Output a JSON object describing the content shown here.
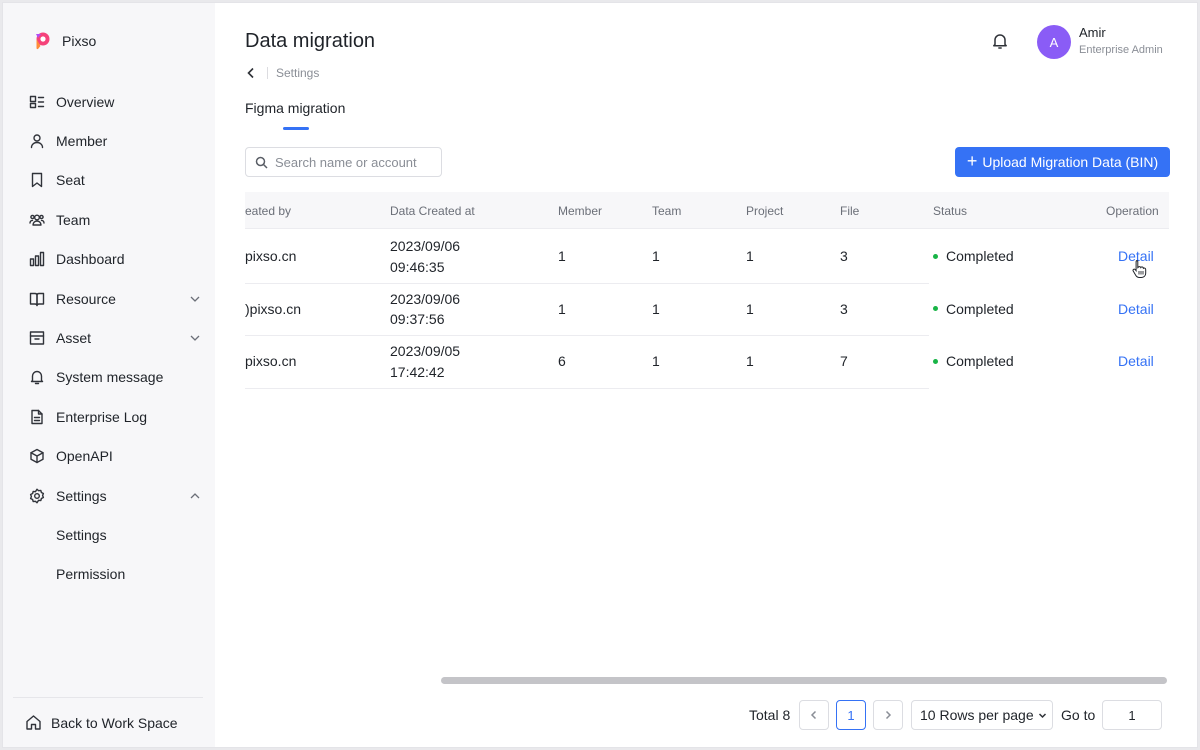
{
  "app": {
    "name": "Pixso",
    "brand_color": "#f5427a"
  },
  "sidebar": {
    "items": [
      {
        "label": "Overview",
        "icon": "overview-icon"
      },
      {
        "label": "Member",
        "icon": "user-icon"
      },
      {
        "label": "Seat",
        "icon": "bookmark-icon"
      },
      {
        "label": "Team",
        "icon": "team-icon"
      },
      {
        "label": "Dashboard",
        "icon": "bar-chart-icon"
      },
      {
        "label": "Resource",
        "icon": "book-icon",
        "expandable": true
      },
      {
        "label": "Asset",
        "icon": "archive-icon",
        "expandable": true
      },
      {
        "label": "System message",
        "icon": "bell-icon"
      },
      {
        "label": "Enterprise Log",
        "icon": "document-icon"
      },
      {
        "label": "OpenAPI",
        "icon": "cube-icon"
      },
      {
        "label": "Settings",
        "icon": "gear-icon",
        "expanded": true
      }
    ],
    "sub_items": [
      "Settings",
      "Permission"
    ],
    "back_label": "Back to Work Space"
  },
  "header": {
    "title": "Data migration",
    "breadcrumb": "Settings",
    "user": {
      "initial": "A",
      "name": "Amir",
      "role": "Enterprise Admin",
      "avatar_color": "#8a5cf6"
    }
  },
  "tabs": [
    {
      "label": "Figma migration",
      "active": true
    }
  ],
  "search": {
    "placeholder": "Search name or account",
    "value": ""
  },
  "upload_button": {
    "plus": "+",
    "label": "Upload Migration Data (BIN)"
  },
  "table": {
    "columns": [
      "eated by",
      "Data Created at",
      "Member",
      "Team",
      "Project",
      "File",
      "Status",
      "Operation"
    ],
    "rows": [
      {
        "created_by": "pixso.cn",
        "date": "2023/09/06",
        "time": "09:46:35",
        "member": "1",
        "team": "1",
        "project": "1",
        "file": "3",
        "status": "Completed",
        "operation": "Detail"
      },
      {
        "created_by": ")pixso.cn",
        "date": "2023/09/06",
        "time": "09:37:56",
        "member": "1",
        "team": "1",
        "project": "1",
        "file": "3",
        "status": "Completed",
        "operation": "Detail"
      },
      {
        "created_by": "pixso.cn",
        "date": "2023/09/05",
        "time": "17:42:42",
        "member": "6",
        "team": "1",
        "project": "1",
        "file": "7",
        "status": "Completed",
        "operation": "Detail"
      }
    ]
  },
  "pagination": {
    "total_label": "Total 8",
    "current_page": "1",
    "rows_per_page": "10 Rows per page",
    "goto_label": "Go to",
    "goto_value": "1"
  },
  "colors": {
    "accent": "#3572f5",
    "status_completed": "#18b446"
  }
}
